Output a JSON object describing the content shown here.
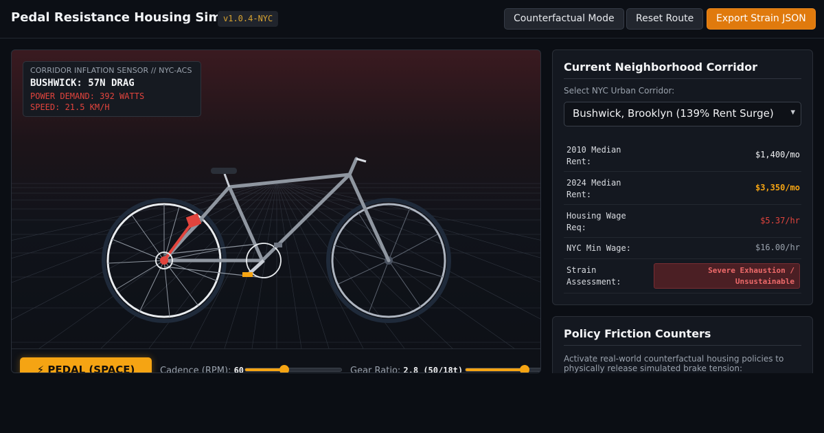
{
  "header": {
    "title": "Pedal Resistance Housing Sim",
    "version": "v1.0.4-NYC",
    "buttons": {
      "counterfactual": "Counterfactual Mode",
      "reset": "Reset Route",
      "export": "Export Strain JSON"
    }
  },
  "sensor": {
    "caption": "CORRIDOR INFLATION SENSOR // NYC-ACS",
    "headline": "BUSHWICK: 57N DRAG",
    "power": "POWER DEMAND: 392 WATTS",
    "speed": "SPEED: 21.5 KM/H"
  },
  "controls": {
    "pedal_label": "⚡ PEDAL (SPACE)",
    "cadence_label": "Cadence (RPM):",
    "cadence_value": "60",
    "cadence_level": 0.41,
    "gear_label": "Gear Ratio:",
    "gear_value": "2.8 (50/18t)",
    "gear_level": 0.58
  },
  "corridor": {
    "title": "Current Neighborhood Corridor",
    "select_label": "Select NYC Urban Corridor:",
    "selected": "Bushwick, Brooklyn (139% Rent Surge)",
    "rows": [
      {
        "label_1": "2010 Median",
        "label_2": "Rent:",
        "value": "$1,400/mo",
        "color": "#f2f3f5"
      },
      {
        "label_1": "2024 Median",
        "label_2": "Rent:",
        "value": "$3,350/mo",
        "color": "#f5a413"
      },
      {
        "label_1": "Housing Wage",
        "label_2": "Req:",
        "value": "$5.37/hr",
        "color": "#e2443d"
      },
      {
        "label_1": "NYC Min Wage:",
        "label_2": "",
        "value": "$16.00/hr",
        "color": "#9aa2ad"
      }
    ],
    "strain_label_1": "Strain",
    "strain_label_2": "Assessment:",
    "strain_value_1": "Severe Exhaustion /",
    "strain_value_2": "Unsustainable"
  },
  "policy": {
    "title": "Policy Friction Counters",
    "desc_1": "Activate real-world counterfactual housing policies to",
    "desc_2": "physically release simulated brake tension:"
  },
  "colors": {
    "accent": "#f5a413",
    "danger": "#e2443d",
    "export_button": "#e07a0d"
  }
}
